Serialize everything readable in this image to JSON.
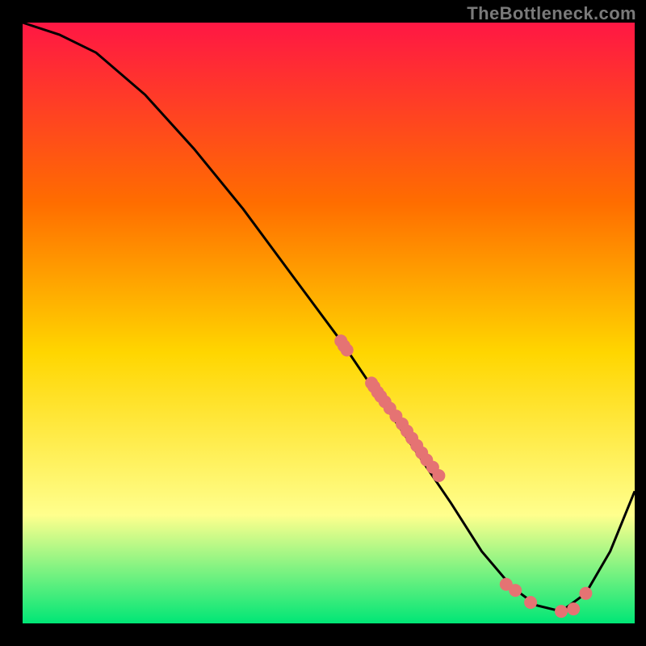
{
  "watermark": "TheBottleneck.com",
  "chart_data": {
    "type": "line",
    "title": "",
    "xlabel": "",
    "ylabel": "",
    "xlim": [
      0,
      100
    ],
    "ylim": [
      0,
      100
    ],
    "grid": false,
    "series": [
      {
        "name": "curve",
        "x": [
          0,
          6,
          12,
          20,
          28,
          36,
          44,
          52,
          58,
          64,
          70,
          75,
          80,
          84,
          88,
          92,
          96,
          100
        ],
        "y": [
          100,
          98,
          95,
          88,
          79,
          69,
          58,
          47,
          38,
          29,
          20,
          12,
          6,
          3,
          2,
          5,
          12,
          22
        ]
      }
    ],
    "scatter": [
      {
        "name": "dots",
        "x": [
          52,
          52.5,
          53,
          57,
          57.4,
          58,
          58.5,
          59.2,
          60,
          61,
          62,
          62.8,
          63.6,
          64.4,
          65.2,
          66,
          67,
          68,
          79,
          80.5,
          83,
          88,
          90,
          92
        ],
        "y": [
          47,
          46.2,
          45.5,
          40,
          39.4,
          38.5,
          37.8,
          36.9,
          35.8,
          34.5,
          33.2,
          32,
          30.8,
          29.6,
          28.4,
          27.2,
          26,
          24.6,
          6.5,
          5.5,
          3.5,
          2,
          2.4,
          5
        ]
      }
    ],
    "colors": {
      "gradient_top": "#ff1744",
      "gradient_mid1": "#ff6d00",
      "gradient_mid2": "#ffd600",
      "gradient_mid3": "#ffff8d",
      "gradient_bottom": "#00e676",
      "curve": "#000000",
      "dot": "#e57373",
      "frame": "#000000"
    }
  }
}
